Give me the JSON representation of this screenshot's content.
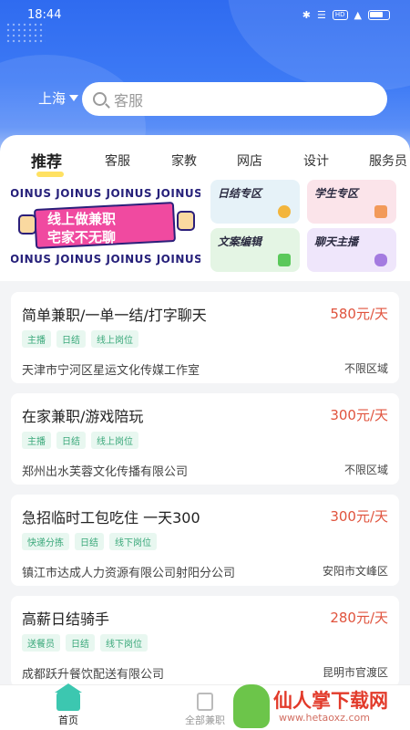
{
  "status_bar": {
    "time": "18:44",
    "icons": [
      "bluetooth-icon",
      "wifi-icon",
      "hd-badge",
      "signal-icon",
      "battery-icon"
    ],
    "hd_label": "HD"
  },
  "header": {
    "city": "上海",
    "search_placeholder": "客服"
  },
  "tabs": [
    {
      "label": "推荐",
      "active": true
    },
    {
      "label": "客服"
    },
    {
      "label": "家教"
    },
    {
      "label": "网店"
    },
    {
      "label": "设计"
    },
    {
      "label": "服务员"
    }
  ],
  "banner": {
    "marquee": "JOINUS JOINUS JOINUS JOINUS",
    "line1": "线上做兼职",
    "line2": "宅家不无聊"
  },
  "zones": [
    {
      "label": "日结专区",
      "bg": "#e6f2f8",
      "accent": "#f3b53c"
    },
    {
      "label": "学生专区",
      "bg": "#fbe4ea",
      "accent": "#f29a5a"
    },
    {
      "label": "文案编辑",
      "bg": "#e4f5e4",
      "accent": "#5ac85a"
    },
    {
      "label": "聊天主播",
      "bg": "#efe6fb",
      "accent": "#a47be0"
    }
  ],
  "jobs": [
    {
      "title": "简单兼职/一单一结/打字聊天",
      "pay": "580元/天",
      "tags": [
        "主播",
        "日结",
        "线上岗位"
      ],
      "company": "天津市宁河区星运文化传媒工作室",
      "area": "不限区域"
    },
    {
      "title": "在家兼职/游戏陪玩",
      "pay": "300元/天",
      "tags": [
        "主播",
        "日结",
        "线上岗位"
      ],
      "company": "郑州出水芙蓉文化传播有限公司",
      "area": "不限区域"
    },
    {
      "title": "急招临时工包吃住 一天300",
      "pay": "300元/天",
      "tags": [
        "快递分拣",
        "日结",
        "线下岗位"
      ],
      "company": "镇江市达成人力资源有限公司射阳分公司",
      "area": "安阳市文峰区"
    },
    {
      "title": "高薪日结骑手",
      "pay": "280元/天",
      "tags": [
        "送餐员",
        "日结",
        "线下岗位"
      ],
      "company": "成都跃升餐饮配送有限公司",
      "area": "昆明市官渡区"
    }
  ],
  "bottom_nav": [
    {
      "label": "首页",
      "active": true
    },
    {
      "label": "全部兼职"
    }
  ],
  "watermark": {
    "text": "仙人掌下载网",
    "url": "www.hetaoxz.com"
  },
  "colors": {
    "primary": "#2f6bf0",
    "pay": "#e0533d",
    "tag_text": "#3aa87a",
    "tag_bg": "#e8f7f0",
    "home_icon": "#3cc7b0"
  }
}
